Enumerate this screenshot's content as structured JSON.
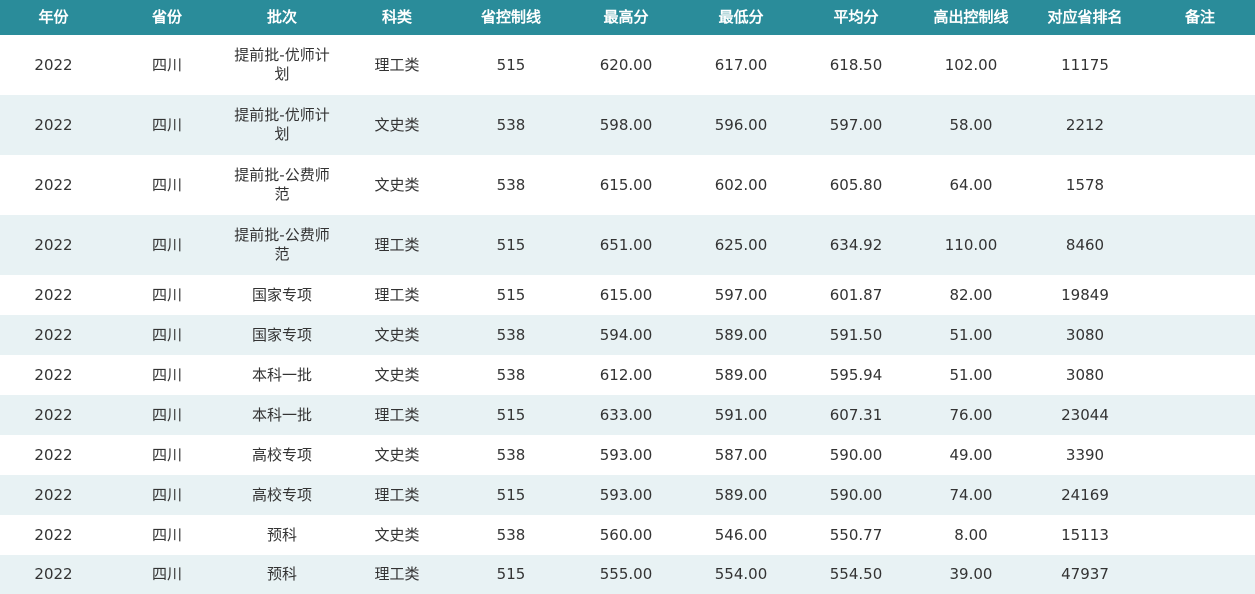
{
  "columns": [
    "年份",
    "省份",
    "批次",
    "科类",
    "省控制线",
    "最高分",
    "最低分",
    "平均分",
    "高出控制线",
    "对应省排名",
    "备注"
  ],
  "rows": [
    {
      "year": "2022",
      "province": "四川",
      "batch": "提前批-优师计划",
      "category": "理工类",
      "control_line": "515",
      "max": "620.00",
      "min": "617.00",
      "avg": "618.50",
      "above": "102.00",
      "rank": "11175",
      "note": ""
    },
    {
      "year": "2022",
      "province": "四川",
      "batch": "提前批-优师计划",
      "category": "文史类",
      "control_line": "538",
      "max": "598.00",
      "min": "596.00",
      "avg": "597.00",
      "above": "58.00",
      "rank": "2212",
      "note": ""
    },
    {
      "year": "2022",
      "province": "四川",
      "batch": "提前批-公费师范",
      "category": "文史类",
      "control_line": "538",
      "max": "615.00",
      "min": "602.00",
      "avg": "605.80",
      "above": "64.00",
      "rank": "1578",
      "note": ""
    },
    {
      "year": "2022",
      "province": "四川",
      "batch": "提前批-公费师范",
      "category": "理工类",
      "control_line": "515",
      "max": "651.00",
      "min": "625.00",
      "avg": "634.92",
      "above": "110.00",
      "rank": "8460",
      "note": ""
    },
    {
      "year": "2022",
      "province": "四川",
      "batch": "国家专项",
      "category": "理工类",
      "control_line": "515",
      "max": "615.00",
      "min": "597.00",
      "avg": "601.87",
      "above": "82.00",
      "rank": "19849",
      "note": ""
    },
    {
      "year": "2022",
      "province": "四川",
      "batch": "国家专项",
      "category": "文史类",
      "control_line": "538",
      "max": "594.00",
      "min": "589.00",
      "avg": "591.50",
      "above": "51.00",
      "rank": "3080",
      "note": ""
    },
    {
      "year": "2022",
      "province": "四川",
      "batch": "本科一批",
      "category": "文史类",
      "control_line": "538",
      "max": "612.00",
      "min": "589.00",
      "avg": "595.94",
      "above": "51.00",
      "rank": "3080",
      "note": ""
    },
    {
      "year": "2022",
      "province": "四川",
      "batch": "本科一批",
      "category": "理工类",
      "control_line": "515",
      "max": "633.00",
      "min": "591.00",
      "avg": "607.31",
      "above": "76.00",
      "rank": "23044",
      "note": ""
    },
    {
      "year": "2022",
      "province": "四川",
      "batch": "高校专项",
      "category": "文史类",
      "control_line": "538",
      "max": "593.00",
      "min": "587.00",
      "avg": "590.00",
      "above": "49.00",
      "rank": "3390",
      "note": ""
    },
    {
      "year": "2022",
      "province": "四川",
      "batch": "高校专项",
      "category": "理工类",
      "control_line": "515",
      "max": "593.00",
      "min": "589.00",
      "avg": "590.00",
      "above": "74.00",
      "rank": "24169",
      "note": ""
    },
    {
      "year": "2022",
      "province": "四川",
      "batch": "预科",
      "category": "文史类",
      "control_line": "538",
      "max": "560.00",
      "min": "546.00",
      "avg": "550.77",
      "above": "8.00",
      "rank": "15113",
      "note": ""
    },
    {
      "year": "2022",
      "province": "四川",
      "batch": "预科",
      "category": "理工类",
      "control_line": "515",
      "max": "555.00",
      "min": "554.00",
      "avg": "554.50",
      "above": "39.00",
      "rank": "47937",
      "note": ""
    }
  ],
  "colors": {
    "header_bg": "#2a8c9a",
    "header_text": "#ffffff",
    "row_alt_bg": "#e8f2f4",
    "row_bg": "#ffffff",
    "cell_text": "#333333"
  }
}
